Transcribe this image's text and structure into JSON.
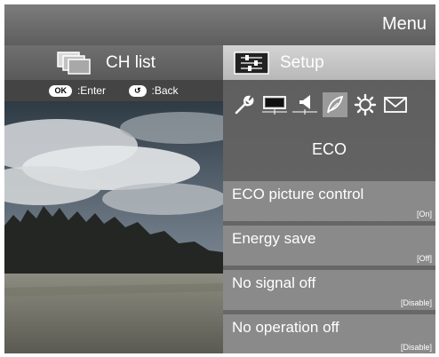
{
  "header": {
    "title": "Menu"
  },
  "tabs": [
    {
      "label": "CH list",
      "icon": "channel-list-icon"
    },
    {
      "label": "Setup",
      "icon": "setup-icon"
    }
  ],
  "hints": {
    "enter_key": "OK",
    "enter_label": ":Enter",
    "back_label": ":Back"
  },
  "setup_icons": [
    "wrench-icon",
    "display-icon",
    "speaker-icon",
    "leaf-icon",
    "gear-icon",
    "envelope-icon"
  ],
  "category": {
    "label": "ECO"
  },
  "settings": [
    {
      "label": "ECO picture control",
      "value": "[On]"
    },
    {
      "label": "Energy save",
      "value": "[Off]"
    },
    {
      "label": "No signal off",
      "value": "[Disable]"
    },
    {
      "label": "No operation off",
      "value": "[Disable]"
    }
  ]
}
